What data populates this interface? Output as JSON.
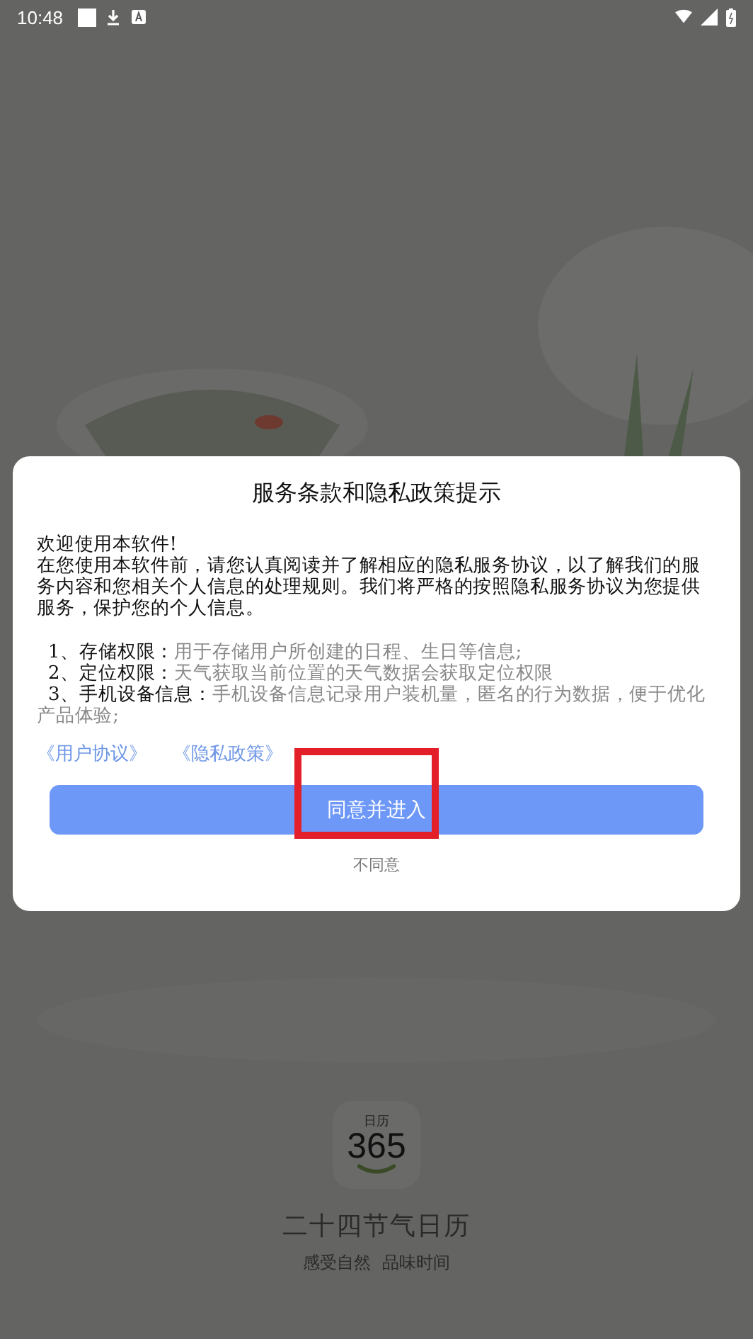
{
  "status_bar": {
    "time": "10:48"
  },
  "dialog": {
    "title": "服务条款和隐私政策提示",
    "greeting": "欢迎使用本软件!",
    "intro": "在您使用本软件前，请您认真阅读并了解相应的隐私服务协议，以了解我们的服务内容和您相关个人信息的处理规则。我们将严格的按照隐私服务协议为您提供服务，保护您的个人信息。",
    "permissions": [
      {
        "label": "1、存储权限：",
        "text": "用于存储用户所创建的日程、生日等信息;"
      },
      {
        "label": "2、定位权限：",
        "text": "天气获取当前位置的天气数据会获取定位权限"
      },
      {
        "label": "3、手机设备信息：",
        "text": "手机设备信息记录用户装机量，匿名的行为数据，便于优化产品体验;"
      }
    ],
    "links": [
      "《用户协议》",
      "《隐私政策》"
    ],
    "agree_button": "同意并进入",
    "decline": "不同意"
  },
  "app": {
    "logo_label": "日历",
    "logo_number": "365",
    "name": "二十四节气日历",
    "slogan": "感受自然  品味时间"
  }
}
